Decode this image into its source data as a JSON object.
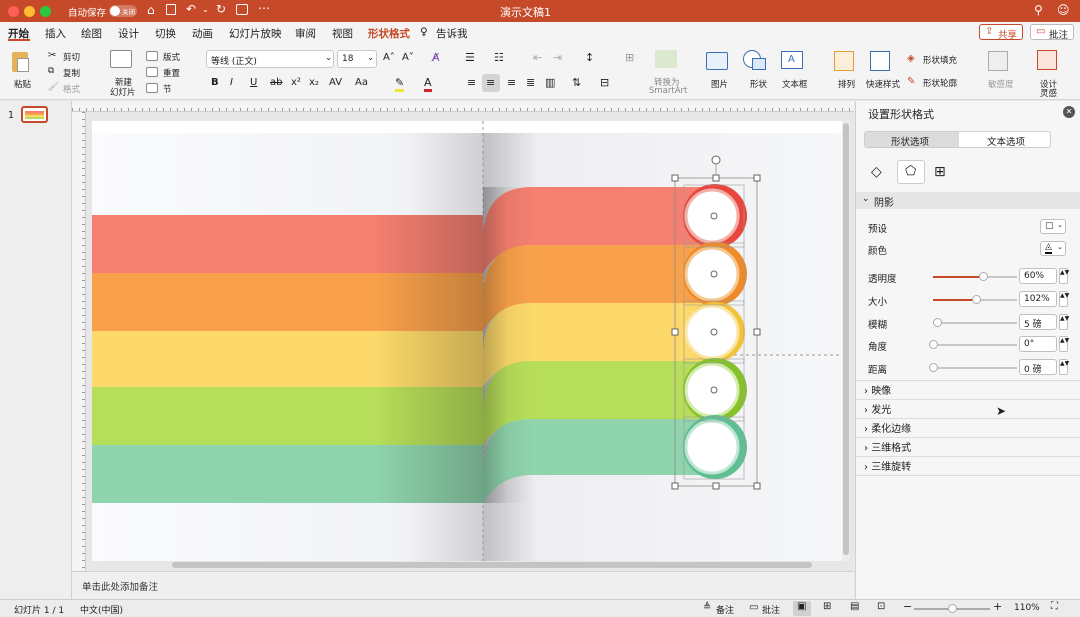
{
  "titlebar": {
    "autosave_label": "自动保存",
    "autosave_state": "关闭",
    "doc_title": "演示文稿1"
  },
  "tabs": [
    "开始",
    "插入",
    "绘图",
    "设计",
    "切换",
    "动画",
    "幻灯片放映",
    "审阅",
    "视图",
    "形状格式",
    "告诉我"
  ],
  "share": {
    "share_label": "共享",
    "comment_label": "批注"
  },
  "ribbon": {
    "paste": "粘贴",
    "cut": "剪切",
    "copy": "复制",
    "format": "格式",
    "new_slide_1": "新建",
    "new_slide_2": "幻灯片",
    "layout": "版式",
    "reset": "重置",
    "section": "节",
    "font_name": "等线 (正文)",
    "font_size": "18",
    "convert_1": "转换为",
    "convert_2": "SmartArt",
    "picture": "图片",
    "shape": "形状",
    "textbox": "文本框",
    "arrange": "排列",
    "quick_styles": "快速样式",
    "shape_fill": "形状填充",
    "shape_outline": "形状轮廓",
    "sensitivity": "敏感度",
    "designer_1": "设计",
    "designer_2": "灵感"
  },
  "thumbs": {
    "slide_number": "1"
  },
  "notes": {
    "placeholder": "单击此处添加备注"
  },
  "status": {
    "slide_counter": "幻灯片 1 / 1",
    "language": "中文(中国)",
    "notes_btn": "备注",
    "comments_btn": "批注",
    "zoom": "110%"
  },
  "pane": {
    "title": "设置形状格式",
    "tab_shape": "形状选项",
    "tab_text": "文本选项",
    "shadow_header": "阴影",
    "preset_label": "预设",
    "color_label": "颜色",
    "rows": [
      {
        "label": "透明度",
        "value": "60%",
        "level": 0.6
      },
      {
        "label": "大小",
        "value": "102%",
        "level": 0.51
      },
      {
        "label": "模糊",
        "value": "5 磅",
        "level": 0.05
      },
      {
        "label": "角度",
        "value": "0°",
        "level": 0.0
      },
      {
        "label": "距离",
        "value": "0 磅",
        "level": 0.0
      }
    ],
    "collapsed": [
      "映像",
      "发光",
      "柔化边缘",
      "三维格式",
      "三维旋转"
    ]
  },
  "colors": {
    "accent": "#c64a2a",
    "band1": "#f57f70",
    "band2": "#f9a14a",
    "band3": "#fcd96a",
    "band4": "#b7de5a",
    "band5": "#8fd4ad"
  }
}
